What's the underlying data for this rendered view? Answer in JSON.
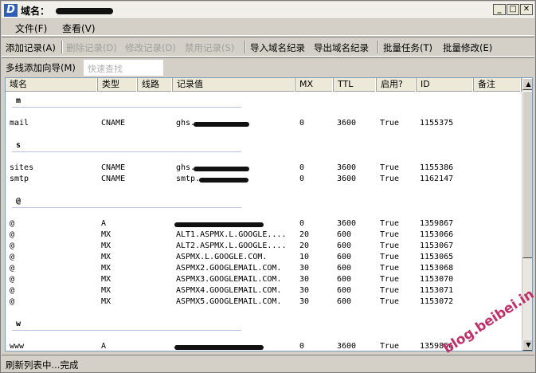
{
  "window": {
    "title": "域名："
  },
  "menu": {
    "file": "文件(F)",
    "view": "查看(V)"
  },
  "toolbar": {
    "add": "添加记录(A)",
    "delete": "删除记录(D)",
    "edit": "修改记录(D)",
    "disable": "禁用记录(S)",
    "import": "导入域名纪录",
    "export": "导出域名纪录",
    "batch_task": "批量任务(T)",
    "batch_edit": "批量修改(E)"
  },
  "toolbar2": {
    "wizard": "多线添加向导(M)",
    "search_placeholder": "快速查找"
  },
  "columns": [
    "域名",
    "类型",
    "线路",
    "记录值",
    "MX",
    "TTL",
    "启用?",
    "ID",
    "备注"
  ],
  "groups": [
    {
      "name": "m",
      "records": [
        {
          "host": "mail",
          "type": "CNAME",
          "line": "",
          "value": "ghs.",
          "redacted": true,
          "mx": "0",
          "ttl": "3600",
          "enabled": "True",
          "id": "1155375"
        }
      ]
    },
    {
      "name": "s",
      "records": [
        {
          "host": "sites",
          "type": "CNAME",
          "line": "",
          "value": "ghs.",
          "redacted": true,
          "mx": "0",
          "ttl": "3600",
          "enabled": "True",
          "id": "1155386"
        },
        {
          "host": "smtp",
          "type": "CNAME",
          "line": "",
          "value": "smtp.",
          "redacted": true,
          "mx": "0",
          "ttl": "3600",
          "enabled": "True",
          "id": "1162147"
        }
      ]
    },
    {
      "name": "@",
      "records": [
        {
          "host": "@",
          "type": "A",
          "line": "",
          "value": "",
          "redacted": true,
          "mx": "0",
          "ttl": "3600",
          "enabled": "True",
          "id": "1359867"
        },
        {
          "host": "@",
          "type": "MX",
          "line": "",
          "value": "ALT1.ASPMX.L.GOOGLE....",
          "redacted": false,
          "mx": "20",
          "ttl": "600",
          "enabled": "True",
          "id": "1153066"
        },
        {
          "host": "@",
          "type": "MX",
          "line": "",
          "value": "ALT2.ASPMX.L.GOOGLE....",
          "redacted": false,
          "mx": "20",
          "ttl": "600",
          "enabled": "True",
          "id": "1153067"
        },
        {
          "host": "@",
          "type": "MX",
          "line": "",
          "value": "ASPMX.L.GOOGLE.COM.",
          "redacted": false,
          "mx": "10",
          "ttl": "600",
          "enabled": "True",
          "id": "1153065"
        },
        {
          "host": "@",
          "type": "MX",
          "line": "",
          "value": "ASPMX2.GOOGLEMAIL.COM.",
          "redacted": false,
          "mx": "30",
          "ttl": "600",
          "enabled": "True",
          "id": "1153068"
        },
        {
          "host": "@",
          "type": "MX",
          "line": "",
          "value": "ASPMX3.GOOGLEMAIL.COM.",
          "redacted": false,
          "mx": "30",
          "ttl": "600",
          "enabled": "True",
          "id": "1153070"
        },
        {
          "host": "@",
          "type": "MX",
          "line": "",
          "value": "ASPMX4.GOOGLEMAIL.COM.",
          "redacted": false,
          "mx": "30",
          "ttl": "600",
          "enabled": "True",
          "id": "1153071"
        },
        {
          "host": "@",
          "type": "MX",
          "line": "",
          "value": "ASPMX5.GOOGLEMAIL.COM.",
          "redacted": false,
          "mx": "30",
          "ttl": "600",
          "enabled": "True",
          "id": "1153072"
        }
      ]
    },
    {
      "name": "w",
      "records": [
        {
          "host": "www",
          "type": "A",
          "line": "",
          "value": "",
          "redacted": true,
          "mx": "0",
          "ttl": "3600",
          "enabled": "True",
          "id": "1359866"
        }
      ]
    }
  ],
  "status": {
    "text": "刷新列表中...完成"
  },
  "watermark": "blog.beibei.in",
  "colors": {
    "titlebar_icon": "#2e5fb8",
    "watermark": "#c0306a"
  }
}
